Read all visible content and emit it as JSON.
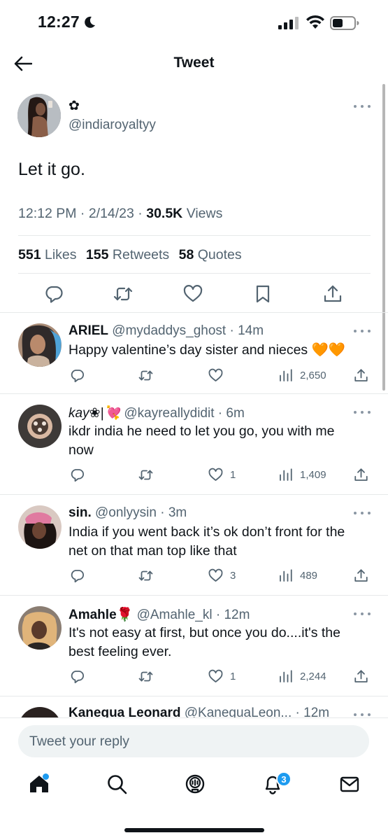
{
  "status_bar": {
    "time": "12:27"
  },
  "header": {
    "title": "Tweet"
  },
  "tweet": {
    "author_name": "✿",
    "handle": "@indiaroyaltyy",
    "text": "Let it go.",
    "time": "12:12 PM",
    "date": "2/14/23",
    "views_count": "30.5K",
    "views_label": "Views",
    "likes_count": "551",
    "likes_label": "Likes",
    "retweets_count": "155",
    "retweets_label": "Retweets",
    "quotes_count": "58",
    "quotes_label": "Quotes"
  },
  "replies": [
    {
      "name": "ARIEL",
      "handle": "@mydaddys_ghost",
      "time": "14m",
      "text": "Happy valentine’s day sister and nieces 🧡🧡",
      "likes": "",
      "views": "2,650"
    },
    {
      "name": "kay❀|💘",
      "handle": "@kayreallydidit",
      "time": "6m",
      "text": "ikdr india he need to let you go, you with me now",
      "likes": "1",
      "views": "1,409"
    },
    {
      "name": "sin.",
      "handle": "@onlyysin",
      "time": "3m",
      "text": "India if you went back it’s ok don’t front for the net on that man top like that",
      "likes": "3",
      "views": "489"
    },
    {
      "name": "Amahle🌹",
      "handle": "@Amahle_kl",
      "time": "12m",
      "text": "It's not easy at first, but once you do....it's the best feeling ever.",
      "likes": "1",
      "views": "2,244"
    },
    {
      "name": "Kanegua Leonard",
      "handle": "@KaneguaLeon...",
      "time": "12m",
      "text": "",
      "likes": "",
      "views": ""
    }
  ],
  "reply_bar": {
    "placeholder": "Tweet your reply"
  },
  "nav": {
    "notification_count": "3"
  },
  "colors": {
    "accent": "#1d9bf0",
    "text": "#0f1419",
    "secondary": "#536471",
    "divider": "#e7e9ea",
    "heart_orange": "#f4900c"
  }
}
